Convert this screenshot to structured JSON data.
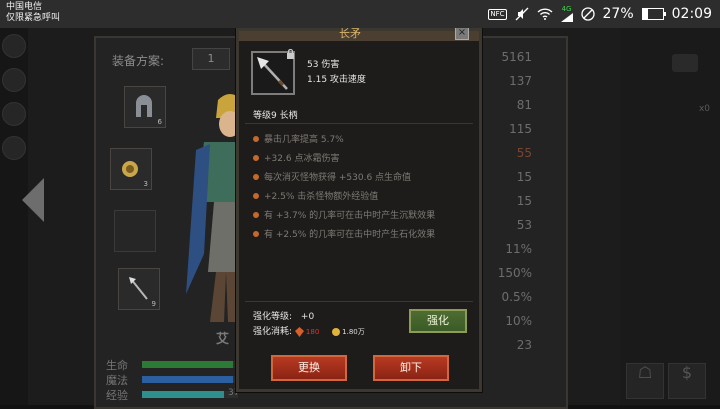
{
  "status_bar": {
    "carrier": "中国电信",
    "emergency": "仅限紧急呼叫",
    "nfc": "NFC",
    "net_type": "4G",
    "battery_pct": "27%",
    "battery_level": 0.27,
    "time": "02:09"
  },
  "background": {
    "equip_scheme_label": "装备方案:",
    "equip_scheme_value": "1",
    "slots": [
      {
        "num": "6"
      },
      {
        "num": "3"
      },
      {
        "num": ""
      },
      {
        "num": "9"
      }
    ],
    "hero_name": "艾",
    "bars": [
      {
        "label": "生命",
        "color": "#2c7a35",
        "fill": 0.95
      },
      {
        "label": "魔法",
        "color": "#2b5fa0",
        "fill": 0.95
      },
      {
        "label": "经验",
        "color": "#2e8f8f",
        "fill": 0.85,
        "value": "37"
      }
    ],
    "stat_numbers": [
      "5161",
      "137",
      "81",
      "115",
      "55",
      "15",
      "15",
      "53",
      "11%",
      "150%",
      "0.5%",
      "10%",
      "23"
    ],
    "stat_red_index": 4,
    "right_small": "x0"
  },
  "tooltip": {
    "title": "长矛",
    "close_label": "×",
    "damage": "53 伤害",
    "attack_speed": "1.15 攻击速度",
    "level_type": "等级9 长柄",
    "attributes": [
      "暴击几率提高 5.7%",
      "+32.6 点冰霜伤害",
      "每次消灭怪物获得 +530.6 点生命值",
      "+2.5% 击杀怪物额外经验值",
      "有 +3.7% 的几率可在击中时产生沉默效果",
      "有 +2.5% 的几率可在击中时产生石化效果"
    ],
    "enhance_level_label": "强化等级:",
    "enhance_level_value": "+0",
    "enhance_cost_label": "强化消耗:",
    "enhance_cost_item": "180",
    "enhance_cost_gold": "1.80万",
    "enhance_button": "强化",
    "replace_button": "更换",
    "unequip_button": "卸下"
  }
}
